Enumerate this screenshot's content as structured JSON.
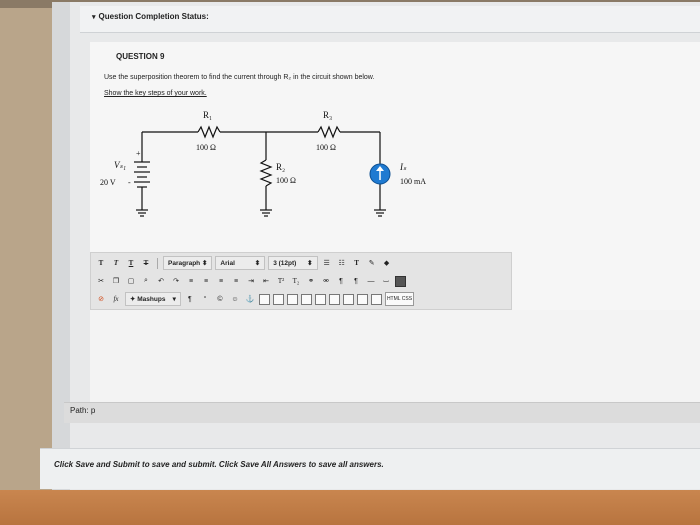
{
  "header": {
    "title": "Question Completion Status:"
  },
  "question": {
    "label": "QUESTION 9",
    "text": "Use the superposition theorem to find the current through R₂ in the circuit shown below.",
    "instruction": "Show the key steps of your work."
  },
  "circuit": {
    "r1": {
      "name": "R₁",
      "value": "100 Ω"
    },
    "r3": {
      "name": "R₃",
      "value": "100 Ω"
    },
    "r2": {
      "name": "R₂",
      "value": "100 Ω"
    },
    "vs": {
      "name": "Vₛ₁",
      "value": "20 V",
      "plus": "+",
      "minus": "-"
    },
    "is": {
      "name": "Iₛ",
      "value": "100 mA"
    }
  },
  "toolbar": {
    "paragraph_select": "Paragraph",
    "font_select": "Arial",
    "size_select": "3 (12pt)",
    "mashups": "Mashups",
    "html_css": "HTML CSS",
    "pilcrow": "¶",
    "quote": "“",
    "fx": "fx"
  },
  "path": {
    "text": "Path: p"
  },
  "footer": {
    "text": "Click Save and Submit to save and submit. Click Save All Answers to save all answers."
  }
}
